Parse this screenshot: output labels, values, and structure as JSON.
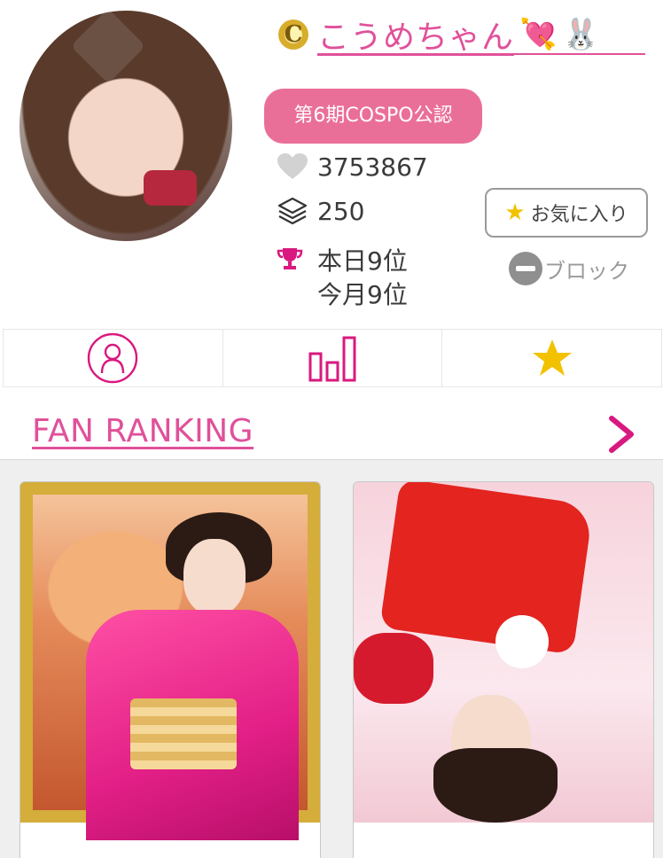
{
  "profile": {
    "name": "こうめちゃん",
    "badge_letter": "C",
    "name_emojis": [
      "💘",
      "🐰"
    ],
    "official_badge": "第6期COSPO公認",
    "likes": "3753867",
    "posts": "250",
    "rank_today": "本日9位",
    "rank_month": "今月9位"
  },
  "actions": {
    "favorite_label": "お気に入り",
    "block_label": "ブロック"
  },
  "tabs": [
    {
      "icon": "profile-icon"
    },
    {
      "icon": "bar-chart-icon"
    },
    {
      "icon": "star-icon"
    }
  ],
  "fan_ranking": {
    "title": "FAN RANKING"
  },
  "colors": {
    "accent_pink": "#e0519a",
    "badge_pink": "#ea6f98",
    "star_yellow": "#f2c200",
    "trophy_pink": "#d9197f"
  }
}
